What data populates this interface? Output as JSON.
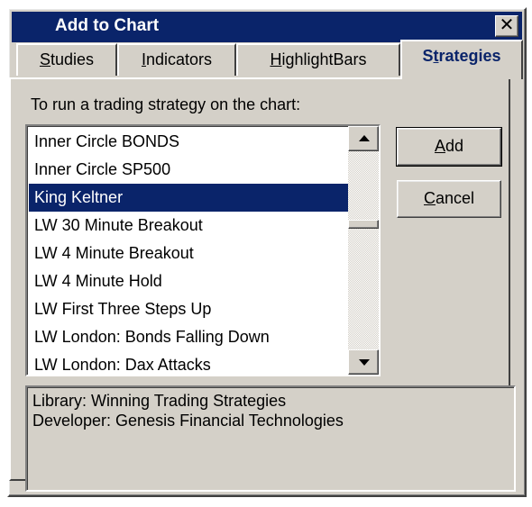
{
  "window": {
    "title": "Add to Chart",
    "close_label": "✕"
  },
  "tabs": [
    {
      "pre": "",
      "accel": "S",
      "post": "tudies"
    },
    {
      "pre": "",
      "accel": "I",
      "post": "ndicators"
    },
    {
      "pre": "",
      "accel": "H",
      "post": "ighlightBars"
    },
    {
      "pre": "S",
      "accel": "t",
      "post": "rategies"
    }
  ],
  "instruction": "To run a trading strategy on the chart:",
  "list": {
    "items": [
      "Inner Circle BONDS",
      "Inner Circle SP500",
      "King Keltner",
      "LW 30 Minute Breakout",
      "LW 4 Minute Breakout",
      "LW 4 Minute Hold",
      "LW First Three Steps Up",
      "LW London:  Bonds Falling Down",
      "LW London:  Dax Attacks"
    ],
    "selected": "King Keltner"
  },
  "buttons": {
    "add": {
      "accel": "A",
      "post": "dd"
    },
    "cancel": {
      "accel": "C",
      "post": "ancel"
    }
  },
  "info": {
    "library": "Library:  Winning Trading Strategies",
    "developer": "Developer:  Genesis Financial Technologies"
  }
}
